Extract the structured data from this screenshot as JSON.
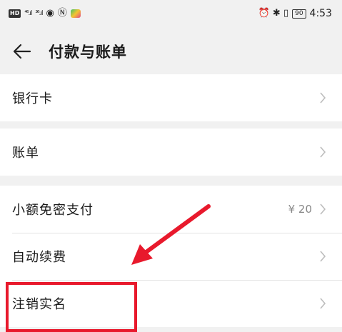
{
  "status_bar": {
    "hd": "HD",
    "sig1": "⁴⁶.ıl",
    "sig2": "³⁶.ıl",
    "eye_glyph": "◉",
    "nfc_glyph": "Ⓝ",
    "right_icons": "⏰ ✱ ▯",
    "battery": "90",
    "time": "4:53"
  },
  "header": {
    "title": "付款与账单"
  },
  "sections": [
    {
      "items": [
        {
          "label": "银行卡",
          "value": ""
        }
      ]
    },
    {
      "items": [
        {
          "label": "账单",
          "value": ""
        }
      ]
    },
    {
      "items": [
        {
          "label": "小额免密支付",
          "value": "¥ 20"
        },
        {
          "label": "自动续费",
          "value": ""
        },
        {
          "label": "注销实名",
          "value": ""
        }
      ]
    }
  ],
  "annotation": {
    "color": "#e8192c"
  }
}
